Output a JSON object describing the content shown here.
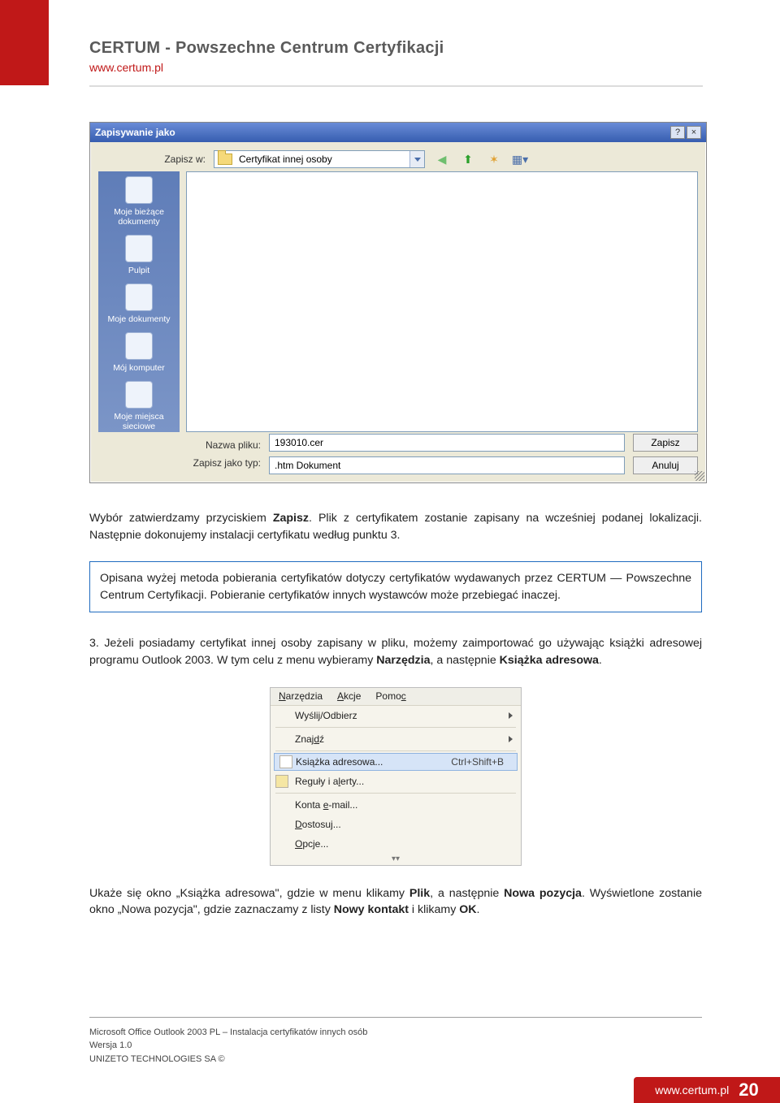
{
  "header": {
    "title": "CERTUM - Powszechne Centrum Certyfikacji",
    "subtitle": "www.certum.pl"
  },
  "dialog": {
    "title": "Zapisywanie jako",
    "help_btn": "?",
    "close_btn": "×",
    "save_in_label": "Zapisz w:",
    "save_in_value": "Certyfikat innej osoby",
    "tool_icons": [
      "back-icon",
      "up-icon",
      "new-folder-icon",
      "views-icon"
    ],
    "places": [
      {
        "id": "recent",
        "label": "Moje bieżące dokumenty"
      },
      {
        "id": "desktop",
        "label": "Pulpit"
      },
      {
        "id": "mydocs",
        "label": "Moje dokumenty"
      },
      {
        "id": "mycomp",
        "label": "Mój komputer"
      },
      {
        "id": "mynet",
        "label": "Moje miejsca sieciowe"
      }
    ],
    "filename_label": "Nazwa pliku:",
    "filename_value": "193010.cer",
    "filetype_label": "Zapisz jako typ:",
    "filetype_value": ".htm Dokument",
    "save_btn": "Zapisz",
    "cancel_btn": "Anuluj"
  },
  "body": {
    "p1_pre": "Wybór zatwierdzamy przyciskiem ",
    "p1_bold": "Zapisz",
    "p1_post": ". Plik z certyfikatem zostanie zapisany na wcześniej podanej lokalizacji. Następnie dokonujemy instalacji certyfikatu według punktu 3.",
    "note": "Opisana wyżej metoda pobierania certyfikatów dotyczy certyfikatów wydawanych przez CERTUM — Powszechne Centrum Certyfikacji. Pobieranie certyfikatów innych wystawców może przebiegać inaczej.",
    "p3_pre": "3. Jeżeli posiadamy certyfikat innej osoby zapisany w pliku, możemy zaimportować go używając książki adresowej programu Outlook 2003. W tym celu z menu wybieramy ",
    "p3_b1": "Narzędzia",
    "p3_mid": ", a następnie ",
    "p3_b2": "Książka adresowa",
    "p3_end": ".",
    "p4_pre": "Ukaże się okno „Książka adresowa\", gdzie w menu klikamy ",
    "p4_b1": "Plik",
    "p4_mid1": ", a następnie ",
    "p4_b2": "Nowa pozycja",
    "p4_mid2": ". Wyświetlone zostanie okno „Nowa pozycja\", gdzie zaznaczamy z listy ",
    "p4_b3": "Nowy kontakt",
    "p4_mid3": " i klikamy ",
    "p4_b4": "OK",
    "p4_end": "."
  },
  "olmenu": {
    "menus": [
      "Narzędzia",
      "Akcje",
      "Pomoc"
    ],
    "items": [
      {
        "label": "Wyślij/Odbierz",
        "caret": true
      },
      {
        "label": "Znajdź",
        "caret": true,
        "underline": "d"
      },
      {
        "label": "Książka adresowa...",
        "shortcut": "Ctrl+Shift+B",
        "highlight": true,
        "icon": true
      },
      {
        "label": "Reguły i alerty...",
        "icon": true
      },
      {
        "label": "Konta e-mail..."
      },
      {
        "label": "Dostosuj..."
      },
      {
        "label": "Opcje..."
      }
    ]
  },
  "footer": {
    "line1": "Microsoft Office Outlook 2003 PL – Instalacja certyfikatów innych osób",
    "line2": "Wersja 1.0",
    "line3": "UNIZETO TECHNOLOGIES SA ©",
    "url": "www.certum.pl",
    "page": "20"
  }
}
